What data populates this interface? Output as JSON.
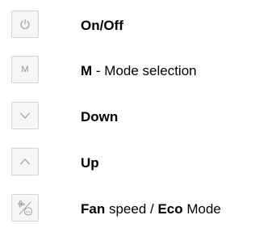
{
  "controls": [
    {
      "icon": "power-icon",
      "label_bold": "On/Off",
      "label_rest": ""
    },
    {
      "icon": "mode-icon",
      "key_glyph": "M",
      "label_bold": "M",
      "label_rest": " - Mode selection"
    },
    {
      "icon": "chevron-down-icon",
      "label_bold": "Down",
      "label_rest": ""
    },
    {
      "icon": "chevron-up-icon",
      "label_bold": "Up",
      "label_rest": ""
    },
    {
      "icon": "fan-eco-icon",
      "key_glyph": "eco",
      "label_bold": "Fan",
      "label_mid": " speed / ",
      "label_bold2": "Eco",
      "label_end": " Mode"
    }
  ],
  "colors": {
    "icon_stroke": "#9a9a9a",
    "key_border": "#d4d4d4",
    "key_background": "#f6f6f6",
    "text": "#000000"
  }
}
